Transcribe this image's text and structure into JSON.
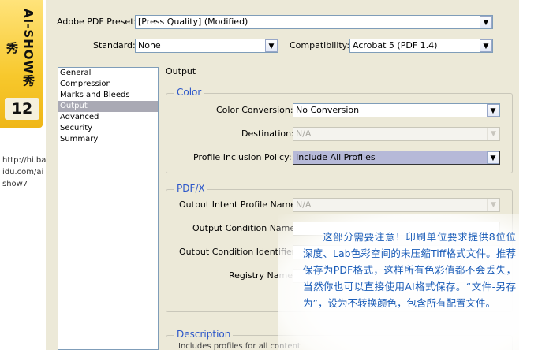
{
  "watermark": {
    "brand": "AI-SHOW秀秀",
    "issue": "12",
    "url": "http://hi.baidu.com/aishow7"
  },
  "top": {
    "preset_label": "Adobe PDF Preset:",
    "preset_value": "[Press Quality] (Modified)",
    "standard_label": "Standard:",
    "standard_value": "None",
    "compat_label": "Compatibility:",
    "compat_value": "Acrobat 5 (PDF 1.4)"
  },
  "sidebar": {
    "items": [
      {
        "label": "General"
      },
      {
        "label": "Compression"
      },
      {
        "label": "Marks and Bleeds"
      },
      {
        "label": "Output"
      },
      {
        "label": "Advanced"
      },
      {
        "label": "Security"
      },
      {
        "label": "Summary"
      }
    ],
    "selected": "Output"
  },
  "main": {
    "title": "Output",
    "color_group": {
      "title": "Color",
      "conversion_label": "Color Conversion:",
      "conversion_value": "No Conversion",
      "destination_label": "Destination:",
      "destination_value": "N/A",
      "profile_label": "Profile Inclusion Policy:",
      "profile_value": "Include All Profiles"
    },
    "pdfx_group": {
      "title": "PDF/X",
      "intent_label": "Output Intent Profile Name:",
      "intent_value": "N/A",
      "condition_name_label": "Output Condition Name:",
      "condition_id_label": "Output Condition Identifier:",
      "registry_label": "Registry Name:"
    },
    "description_group": {
      "title": "Description",
      "text": "Includes profiles for all content"
    }
  },
  "annotation": {
    "text": "这部分需要注意！印刷单位要求提供8位位深度、Lab色彩空间的未压缩Tiff格式文件。推荐保存为PDF格式，这样所有色彩值都不会丢失，当然你也可以直接使用AI格式保存。“文件-另存为”，设为不转换颜色，包含所有配置文件。",
    "color": "#1a5cb8"
  },
  "icons": {
    "dropdown": "▼"
  }
}
